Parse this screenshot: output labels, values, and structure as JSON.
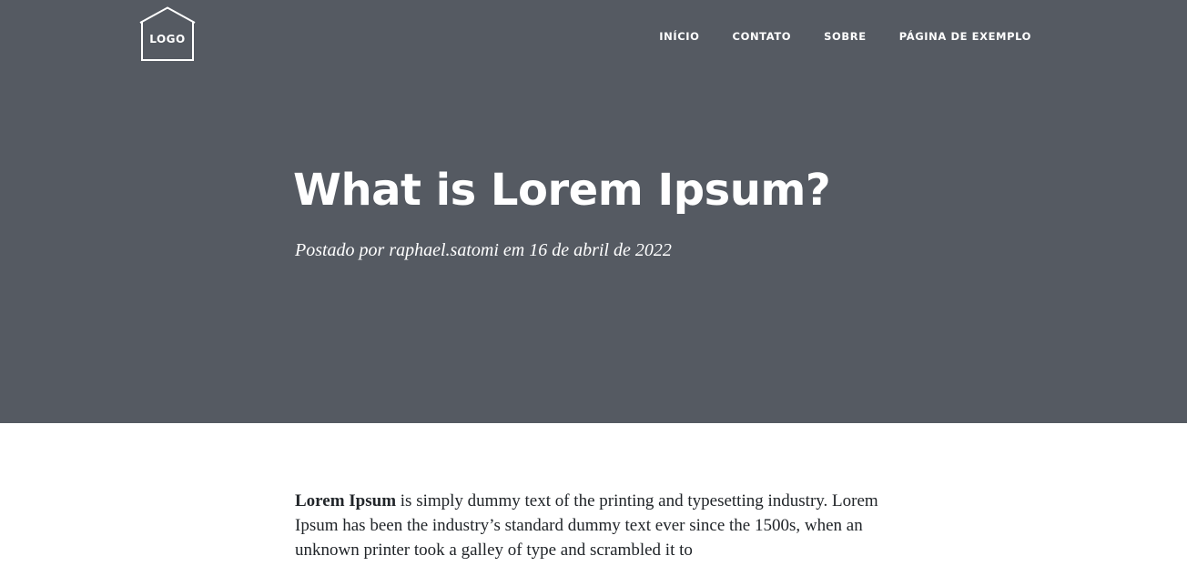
{
  "header": {
    "logo_text": "LOGO",
    "nav": [
      {
        "label": "INÍCIO"
      },
      {
        "label": "CONTATO"
      },
      {
        "label": "SOBRE"
      },
      {
        "label": "PÁGINA DE EXEMPLO"
      }
    ]
  },
  "post": {
    "title": "What is Lorem Ipsum?",
    "meta": "Postado por raphael.satomi em 16 de abril de 2022"
  },
  "content": {
    "lead_bold": "Lorem Ipsum",
    "lead_rest": " is simply dummy text of the printing and typesetting industry. Lorem Ipsum has been the industry’s standard dummy text ever since the 1500s, when an unknown printer took a galley of type and scrambled it to"
  },
  "colors": {
    "hero_background": "#555a62",
    "hero_text": "#ffffff",
    "body_text": "#212529",
    "page_background": "#ffffff"
  },
  "icons": {
    "logo": "house-outline-icon"
  }
}
